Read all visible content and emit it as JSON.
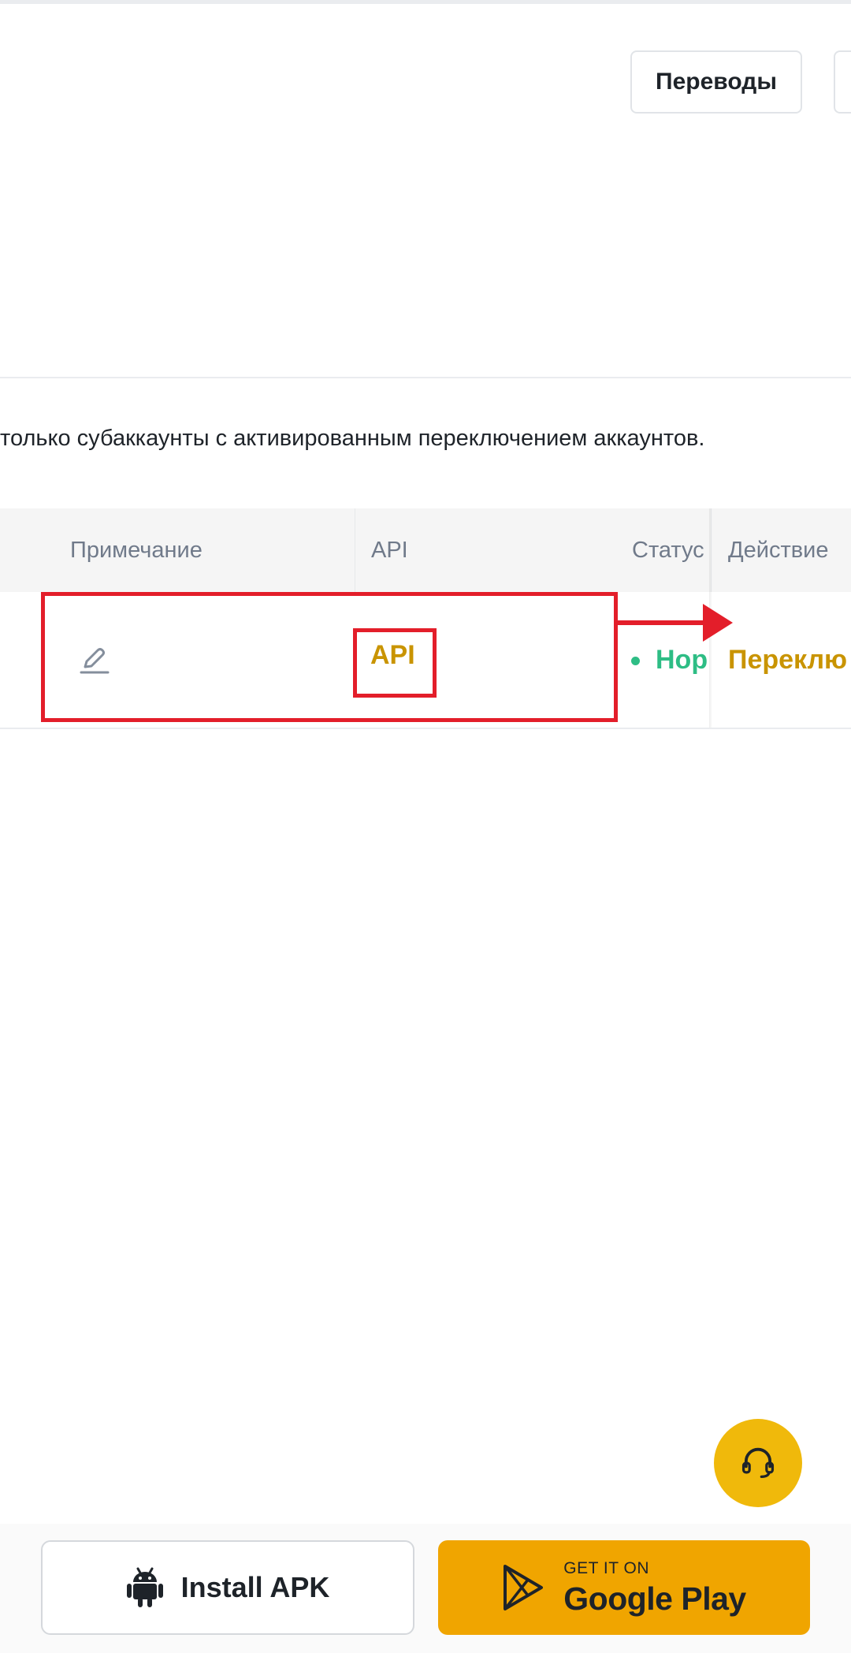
{
  "header": {
    "transfers_label": "Переводы"
  },
  "notice": {
    "text": "только субаккаунты с активированным переключением аккаунтов."
  },
  "table": {
    "columns": [
      "Примечание",
      "API",
      "Статус",
      "Действие"
    ],
    "rows": [
      {
        "note": "",
        "api": "API",
        "status": "Нор",
        "action": "Переклю"
      }
    ]
  },
  "annotation": {
    "color": "#e31e2a"
  },
  "colors": {
    "accent": "#f0b90b",
    "link": "#c99400",
    "status_ok": "#2ebd85"
  },
  "bottom": {
    "install_apk_label": "Install APK",
    "google_play_small": "GET IT ON",
    "google_play_big": "Google Play"
  },
  "icons": {
    "edit": "pencil-icon",
    "support": "headset-icon",
    "android": "android-icon",
    "play": "google-play-icon"
  }
}
